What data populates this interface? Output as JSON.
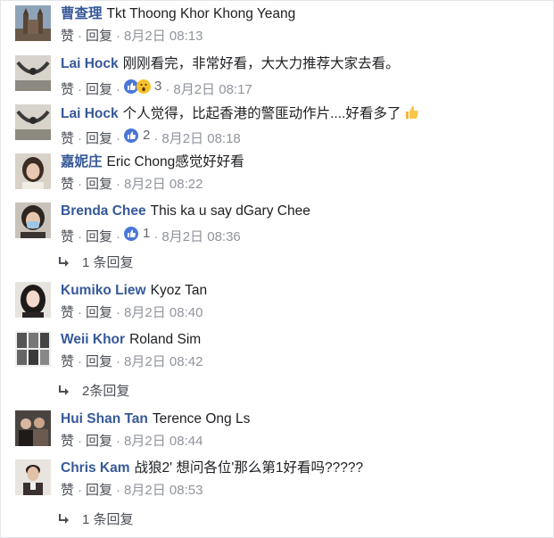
{
  "labels": {
    "like": "赞",
    "reply": "回复",
    "separator": "·"
  },
  "colors": {
    "author": "#365899",
    "meta": "#90949c",
    "like_blue": "#4a76d8",
    "wow_yellow": "#f7c12c"
  },
  "comments": [
    {
      "author": "曹查理",
      "text": "Tkt Thoong Khor Khong Yeang",
      "time": "8月2日 08:13",
      "reaction_count": "",
      "reaction_icons": [],
      "avatar_icon": "church-photo-avatar"
    },
    {
      "author": "Lai Hock",
      "text": "刚刚看完，非常好看，大大力推荐大家去看。",
      "time": "8月2日 08:17",
      "reaction_count": "3",
      "reaction_icons": [
        "like-icon",
        "wow-icon"
      ],
      "avatar_icon": "hammock-photo-avatar"
    },
    {
      "author": "Lai Hock",
      "text": "个人觉得，比起香港的警匪动作片....好看多了",
      "time": "8月2日 08:18",
      "reaction_count": "2",
      "reaction_icons": [
        "like-icon"
      ],
      "trailing_emoji": "thumbs-up-emoji",
      "avatar_icon": "hammock-photo-avatar"
    },
    {
      "author": "嘉妮庄",
      "text": "Eric Chong感觉好好看",
      "time": "8月2日 08:22",
      "reaction_count": "",
      "reaction_icons": [],
      "avatar_icon": "woman-portrait-avatar"
    },
    {
      "author": "Brenda Chee",
      "text": "This ka u say dGary Chee",
      "time": "8月2日 08:36",
      "reaction_count": "1",
      "reaction_icons": [
        "like-icon"
      ],
      "avatar_icon": "masked-woman-avatar"
    },
    {
      "author": "Kumiko Liew",
      "text": "Kyoz Tan",
      "time": "8月2日 08:40",
      "reaction_count": "",
      "reaction_icons": [],
      "avatar_icon": "dark-hair-woman-avatar"
    },
    {
      "author": "Weii Khor",
      "text": "Roland Sim",
      "time": "8月2日 08:42",
      "reaction_count": "",
      "reaction_icons": [],
      "avatar_icon": "bw-collage-avatar"
    },
    {
      "author": "Hui Shan Tan",
      "text": "Terence Ong Ls",
      "time": "8月2日 08:44",
      "reaction_count": "",
      "reaction_icons": [],
      "avatar_icon": "group-photo-avatar"
    },
    {
      "author": "Chris Kam",
      "text": "战狼2' 想问各位'那么第1好看吗?????",
      "time": "8月2日 08:53",
      "reaction_count": "",
      "reaction_icons": [],
      "avatar_icon": "man-portrait-avatar"
    }
  ],
  "reply_links": [
    {
      "after": "Brenda Chee",
      "text": "1 条回复"
    },
    {
      "after": "Weii Khor",
      "text": "2条回复"
    },
    {
      "after": "Chris Kam",
      "text": "1 条回复"
    }
  ]
}
